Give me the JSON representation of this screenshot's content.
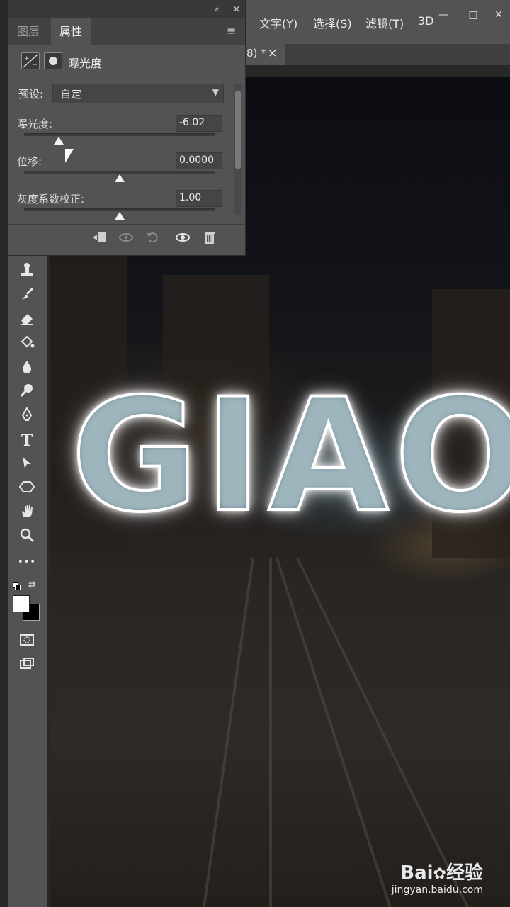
{
  "menu": {
    "items": [
      "文字(Y)",
      "选择(S)",
      "滤镜(T)",
      "3D"
    ],
    "window_controls": {
      "minimize": "—",
      "maximize": "□",
      "close": "✕"
    }
  },
  "document_tab": {
    "label": "8) *",
    "close": "×"
  },
  "panel": {
    "collapse": "«",
    "close": "×",
    "tabs": [
      "图层",
      "属性"
    ],
    "active_tab": "属性",
    "adjustment_title": "曝光度",
    "preset": {
      "label": "预设:",
      "value": "自定"
    },
    "controls": [
      {
        "label": "曝光度:",
        "value": "-6.02",
        "slider_fraction": 0.18
      },
      {
        "label": "位移:",
        "value": "0.0000",
        "slider_fraction": 0.5
      },
      {
        "label": "灰度系数校正:",
        "value": "1.00",
        "slider_fraction": 0.5
      }
    ],
    "footer_icons": [
      "clip-to-layer-icon",
      "view-previous-state-icon",
      "reset-icon",
      "visibility-eye-icon",
      "trash-icon"
    ]
  },
  "toolbar": {
    "tools": [
      "clone-stamp-icon",
      "history-brush-icon",
      "eraser-icon",
      "paint-bucket-icon",
      "blur-icon",
      "dodge-icon",
      "pen-icon",
      "type-icon",
      "path-selection-icon",
      "shape-icon",
      "hand-icon",
      "zoom-icon",
      "more-tools-icon"
    ],
    "type_tool_glyph": "T",
    "more_glyph": "•••",
    "foreground_color": "#ffffff",
    "background_color": "#000000"
  },
  "canvas": {
    "text": "GIAO"
  },
  "watermark": {
    "logo": "Bai",
    "logo_suffix": "经验",
    "url": "jingyan.baidu.com"
  }
}
